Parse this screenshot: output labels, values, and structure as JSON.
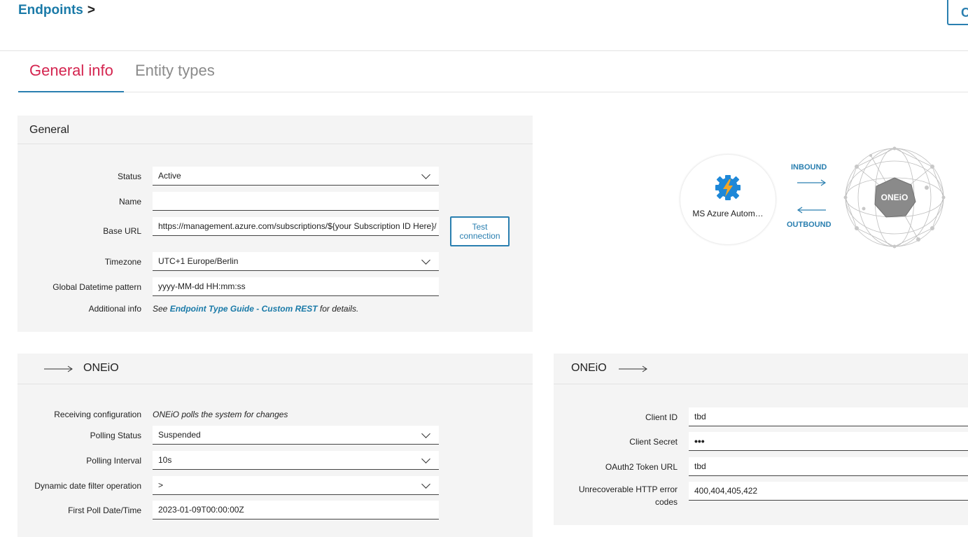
{
  "header": {
    "breadcrumb_link": "Endpoints",
    "breadcrumb_sep": ">",
    "corner_button": "C"
  },
  "tabs": [
    {
      "label": "General info",
      "active": true
    },
    {
      "label": "Entity types",
      "active": false
    }
  ],
  "general": {
    "title": "General",
    "status": {
      "label": "Status",
      "value": "Active"
    },
    "name": {
      "label": "Name",
      "value": ""
    },
    "base_url": {
      "label": "Base URL",
      "value": "https://management.azure.com/subscriptions/${your Subscription ID Here}/"
    },
    "test_button": {
      "line1": "Test",
      "line2": "connection"
    },
    "timezone": {
      "label": "Timezone",
      "value": "UTC+1 Europe/Berlin"
    },
    "datetime": {
      "label": "Global Datetime pattern",
      "value": "yyyy-MM-dd HH:mm:ss"
    },
    "info": {
      "label": "Additional info",
      "prefix": "See ",
      "link": "Endpoint Type Guide - Custom REST",
      "suffix": " for details."
    }
  },
  "diagram": {
    "endpoint_name": "MS Azure Autom…",
    "inbound": "INBOUND",
    "outbound": "OUTBOUND",
    "logo_text": "ONEiO",
    "colors": {
      "flow": "#2a7fb0",
      "azure_blue": "#1e88d8",
      "bolt": "#f5a623"
    }
  },
  "receiving": {
    "title": "ONEiO",
    "config": {
      "label": "Receiving configuration",
      "value": "ONEiO polls the system for changes"
    },
    "polling_status": {
      "label": "Polling Status",
      "value": "Suspended"
    },
    "polling_interval": {
      "label": "Polling Interval",
      "value": "10s"
    },
    "date_filter": {
      "label": "Dynamic date filter operation",
      "value": ">"
    },
    "first_poll": {
      "label": "First Poll Date/Time",
      "value": "2023-01-09T00:00:00Z"
    }
  },
  "sending": {
    "title": "ONEiO",
    "client_id": {
      "label": "Client ID",
      "value": "tbd"
    },
    "client_secret": {
      "label": "Client Secret",
      "value": "•••"
    },
    "token_url": {
      "label": "OAuth2 Token URL",
      "value": "tbd"
    },
    "http_errors": {
      "label_line1": "Unrecoverable HTTP error",
      "label_line2": "codes",
      "value": "400,404,405,422"
    }
  },
  "theme": {
    "accent": "#2a7fb0",
    "tab_active": "#d4244f"
  }
}
